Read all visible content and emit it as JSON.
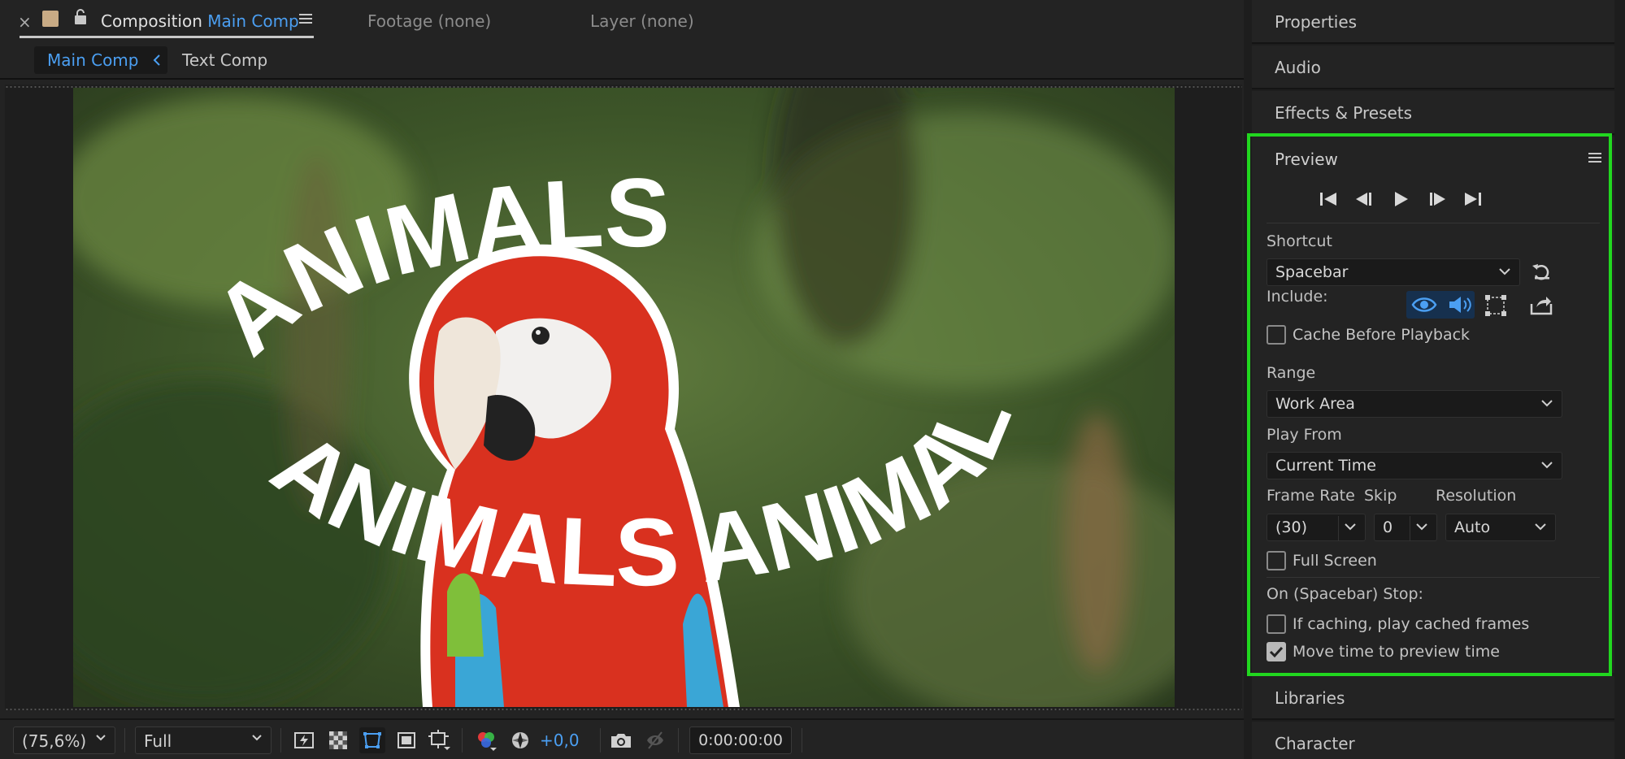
{
  "tabs": {
    "close_glyph": "×",
    "composition_prefix": "Composition",
    "composition_name": "Main Comp",
    "footage": "Footage (none)",
    "layer": "Layer (none)"
  },
  "breadcrumbs": {
    "main": "Main Comp",
    "text": "Text Comp"
  },
  "canvas": {
    "overlay_top": "ANIMALS",
    "overlay_bottom": "ANIMALS ANIMALS"
  },
  "toolbar": {
    "zoom": "(75,6%)",
    "resolution": "Full",
    "exposure": "+0,0",
    "timecode": "0:00:00:00"
  },
  "panels": {
    "properties": "Properties",
    "audio": "Audio",
    "effects": "Effects & Presets",
    "libraries": "Libraries",
    "character": "Character"
  },
  "preview": {
    "title": "Preview",
    "shortcut_label": "Shortcut",
    "shortcut_value": "Spacebar",
    "include_label": "Include:",
    "cache_before_playback": "Cache Before Playback",
    "range_label": "Range",
    "range_value": "Work Area",
    "play_from_label": "Play From",
    "play_from_value": "Current Time",
    "frame_rate_label": "Frame Rate",
    "frame_rate_value": "(30)",
    "skip_label": "Skip",
    "skip_value": "0",
    "resolution_label": "Resolution",
    "resolution_value": "Auto",
    "full_screen": "Full Screen",
    "stop_label": "On (Spacebar) Stop:",
    "if_caching": "If caching, play cached frames",
    "move_time": "Move time to preview time",
    "cache_checked": false,
    "full_screen_checked": false,
    "if_caching_checked": false,
    "move_time_checked": true
  },
  "colors": {
    "accent_blue": "#4b9ff2",
    "highlight_green": "#21d71f",
    "panel_bg": "#232323"
  }
}
